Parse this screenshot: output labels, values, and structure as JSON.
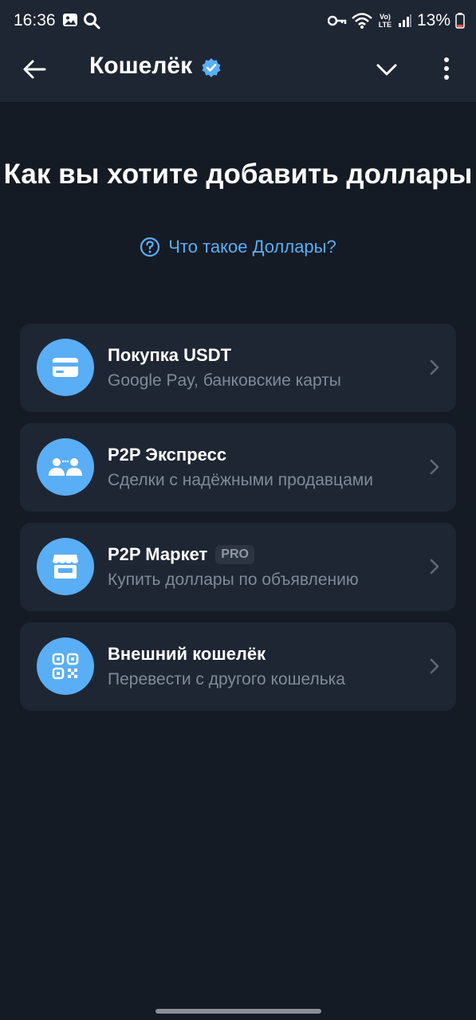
{
  "status_bar": {
    "time": "16:36",
    "battery": "13%",
    "network": "Vo) LTE"
  },
  "appbar": {
    "title": "Кошелёк"
  },
  "heading": "Как вы хотите добавить доллары",
  "help_link": "Что такое Доллары?",
  "options": [
    {
      "title": "Покупка USDT",
      "subtitle": "Google Pay, банковские карты",
      "icon": "card-icon"
    },
    {
      "title": "P2P Экспресс",
      "subtitle": "Сделки с надёжными продавцами",
      "icon": "users-icon"
    },
    {
      "title": "P2P Маркет",
      "badge": "PRO",
      "subtitle": "Купить доллары по объявлению",
      "icon": "store-icon"
    },
    {
      "title": "Внешний кошелёк",
      "subtitle": "Перевести с другого кошелька",
      "icon": "qr-code-icon"
    }
  ],
  "colors": {
    "background": "#151b24",
    "surface": "#1e2633",
    "accent": "#5aaef5",
    "secondary_text": "#7f8a99"
  }
}
